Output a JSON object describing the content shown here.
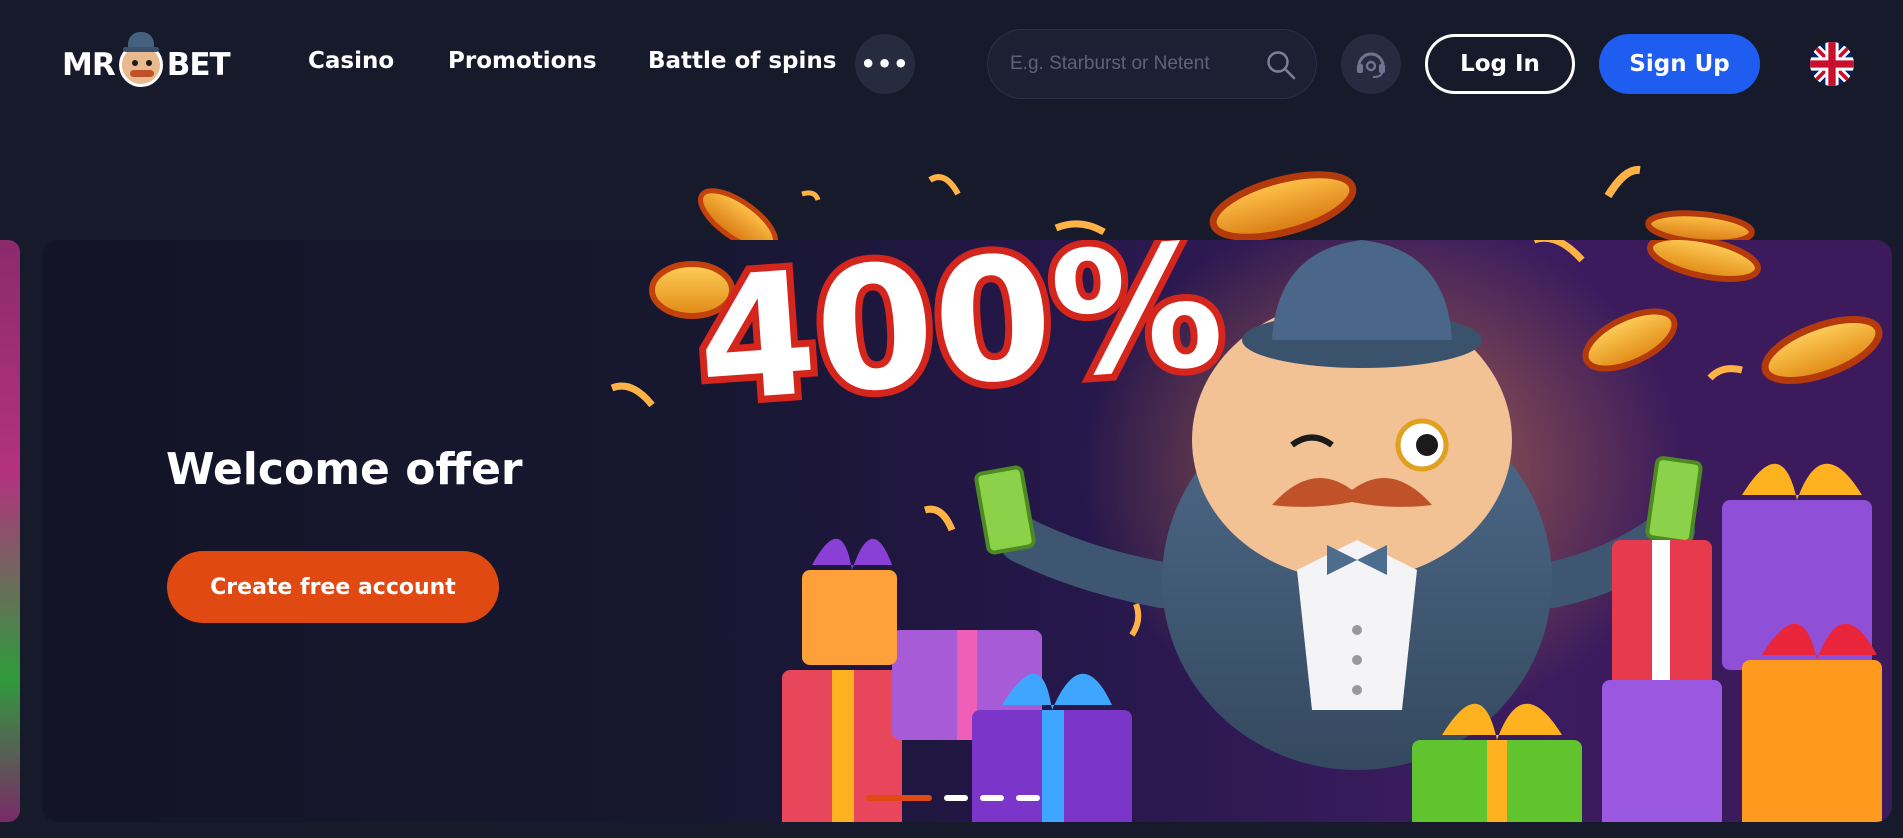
{
  "header": {
    "logo": {
      "left_text": "MR",
      "right_text": "BET"
    },
    "nav": [
      {
        "label": "Casino"
      },
      {
        "label": "Promotions"
      },
      {
        "label": "Battle of spins"
      }
    ],
    "more_label": "•••",
    "search": {
      "placeholder": "E.g. Starburst or Netent",
      "value": ""
    },
    "login_label": "Log In",
    "signup_label": "Sign Up",
    "language_icon": "uk-flag-icon"
  },
  "hero": {
    "bonus_text": "400%",
    "title": "Welcome offer",
    "cta_label": "Create free account",
    "slides": {
      "total": 4,
      "active": 1
    }
  },
  "colors": {
    "background": "#171a2b",
    "signup_blue": "#1f5cf0",
    "cta_orange": "#e04a12",
    "icon_button_bg": "#262b40"
  }
}
